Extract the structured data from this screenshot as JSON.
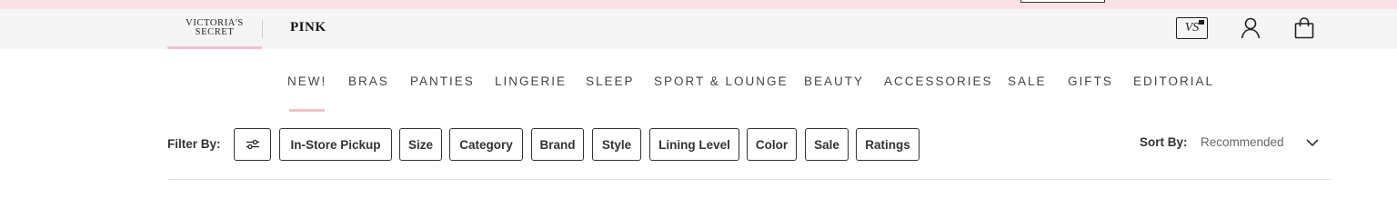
{
  "brands": {
    "victorias_secret_line1": "VICTORIA'S",
    "victorias_secret_line2": "SECRET",
    "pink": "PINK"
  },
  "header_icons": {
    "card_monogram": "VS",
    "icons": [
      "credit-card-icon",
      "account-icon",
      "shopping-bag-icon"
    ]
  },
  "nav": {
    "items": [
      {
        "label": "NEW!"
      },
      {
        "label": "BRAS"
      },
      {
        "label": "PANTIES"
      },
      {
        "label": "LINGERIE"
      },
      {
        "label": "SLEEP"
      },
      {
        "label": "SPORT & LOUNGE"
      },
      {
        "label": "BEAUTY"
      },
      {
        "label": "ACCESSORIES"
      },
      {
        "label": "SALE"
      },
      {
        "label": "GIFTS"
      },
      {
        "label": "EDITORIAL"
      }
    ],
    "active": "NEW!"
  },
  "filters": {
    "label": "Filter By:",
    "chips": [
      {
        "label": "In-Store Pickup"
      },
      {
        "label": "Size"
      },
      {
        "label": "Category"
      },
      {
        "label": "Brand"
      },
      {
        "label": "Style"
      },
      {
        "label": "Lining Level"
      },
      {
        "label": "Color"
      },
      {
        "label": "Sale"
      },
      {
        "label": "Ratings"
      }
    ]
  },
  "sort": {
    "label": "Sort By:",
    "value": "Recommended"
  },
  "colors": {
    "promo_strip": "#f9e1e5",
    "accent_pink": "#f2c3cc",
    "brand_bar": "#f5f5f5"
  }
}
